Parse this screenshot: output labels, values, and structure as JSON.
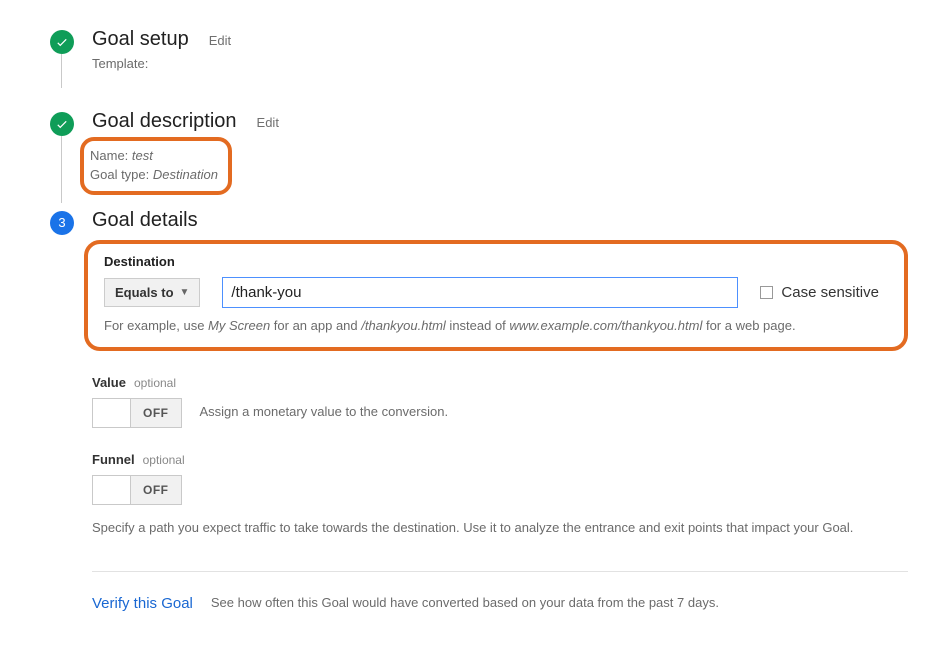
{
  "steps": {
    "setup": {
      "title": "Goal setup",
      "edit": "Edit",
      "template_label": "Template:"
    },
    "desc": {
      "title": "Goal description",
      "edit": "Edit",
      "name_label": "Name:",
      "name_value": "test",
      "type_label": "Goal type:",
      "type_value": "Destination"
    },
    "details": {
      "number": "3",
      "title": "Goal details"
    }
  },
  "destination": {
    "heading": "Destination",
    "match_type": "Equals to",
    "value": "/thank-you",
    "case_sensitive_label": "Case sensitive",
    "hint_prefix": "For example, use ",
    "hint_em1": "My Screen",
    "hint_between": " for an app and ",
    "hint_em2": "/thankyou.html",
    "hint_between2": " instead of ",
    "hint_em3": "www.example.com/thankyou.html",
    "hint_suffix": " for a web page."
  },
  "value_section": {
    "label": "Value",
    "optional": "optional",
    "toggle_state": "OFF",
    "desc": "Assign a monetary value to the conversion."
  },
  "funnel_section": {
    "label": "Funnel",
    "optional": "optional",
    "toggle_state": "OFF",
    "desc": "Specify a path you expect traffic to take towards the destination. Use it to analyze the entrance and exit points that impact your Goal."
  },
  "verify": {
    "link": "Verify this Goal",
    "desc": "See how often this Goal would have converted based on your data from the past 7 days."
  }
}
